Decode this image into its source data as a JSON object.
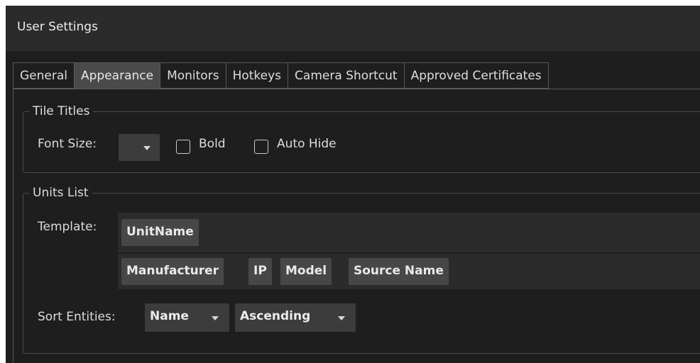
{
  "window": {
    "title": "User Settings"
  },
  "tabs": [
    {
      "label": "General",
      "active": false
    },
    {
      "label": "Appearance",
      "active": true
    },
    {
      "label": "Monitors",
      "active": false
    },
    {
      "label": "Hotkeys",
      "active": false
    },
    {
      "label": "Camera Shortcut",
      "active": false
    },
    {
      "label": "Approved Certificates",
      "active": false
    }
  ],
  "tile_titles": {
    "legend": "Tile Titles",
    "font_size_label": "Font Size:",
    "font_size_value": "",
    "bold_label": "Bold",
    "bold_checked": false,
    "auto_hide_label": "Auto Hide",
    "auto_hide_checked": false
  },
  "units_list": {
    "legend": "Units List",
    "template_label": "Template:",
    "template_fields": [
      "UnitName"
    ],
    "available_fields": [
      "Manufacturer",
      "IP",
      "Model",
      "Source Name"
    ],
    "sort_label": "Sort Entities:",
    "sort_field": "Name",
    "sort_order": "Ascending"
  },
  "colors": {
    "background": "#1e1e1e",
    "title_bar": "#2b2b2b",
    "active_tab": "#4a4a4a",
    "chip": "#474747",
    "control": "#3c3c3c"
  }
}
